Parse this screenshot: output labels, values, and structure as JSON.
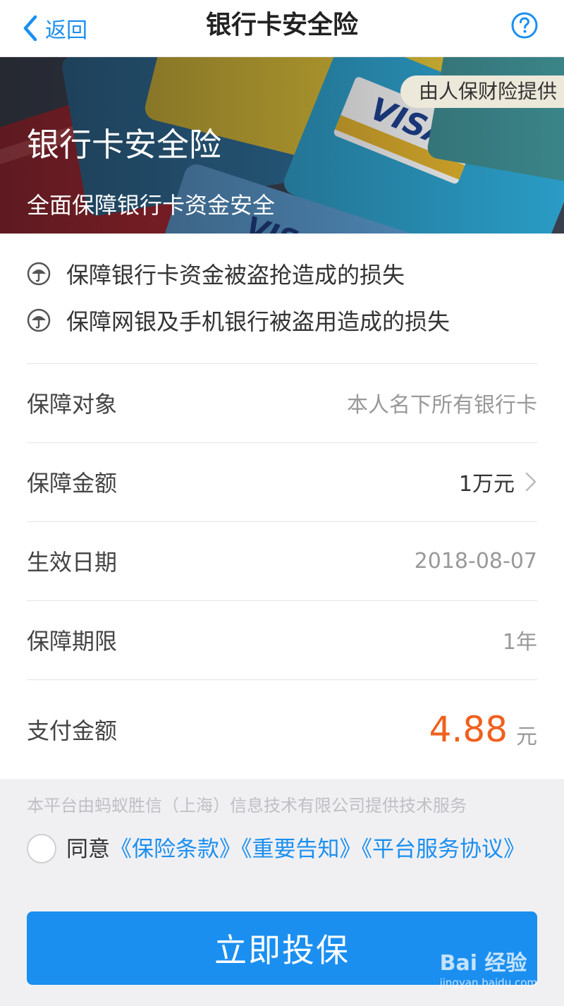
{
  "nav": {
    "back_label": "返回",
    "title": "银行卡安全险",
    "help_icon": "question-circle-icon"
  },
  "banner": {
    "provider": "由人保财险提供",
    "title": "银行卡安全险",
    "subtitle": "全面保障银行卡资金安全"
  },
  "benefits": [
    {
      "icon": "umbrella-icon",
      "text": "保障银行卡资金被盗抢造成的损失"
    },
    {
      "icon": "umbrella-icon",
      "text": "保障网银及手机银行被盗用造成的损失"
    }
  ],
  "details": {
    "subject": {
      "label": "保障对象",
      "value": "本人名下所有银行卡"
    },
    "amount": {
      "label": "保障金额",
      "value": "1万元"
    },
    "effective_date": {
      "label": "生效日期",
      "value": "2018-08-07"
    },
    "term": {
      "label": "保障期限",
      "value": "1年"
    },
    "payment": {
      "label": "支付金额",
      "value": "4.88",
      "unit": "元"
    }
  },
  "footer": {
    "tech_notice": "本平台由蚂蚁胜信（上海）信息技术有限公司提供技术服务",
    "agree_prefix": "同意",
    "links": [
      "《保险条款》",
      "《重要告知》",
      "《平台服务协议》"
    ],
    "agreement_checked": false,
    "submit_label": "立即投保"
  },
  "watermark": {
    "logo": "Bai 经验",
    "sub": "jingyan.baidu.com"
  },
  "colors": {
    "accent": "#1b8ff0",
    "price": "#f0601e"
  }
}
